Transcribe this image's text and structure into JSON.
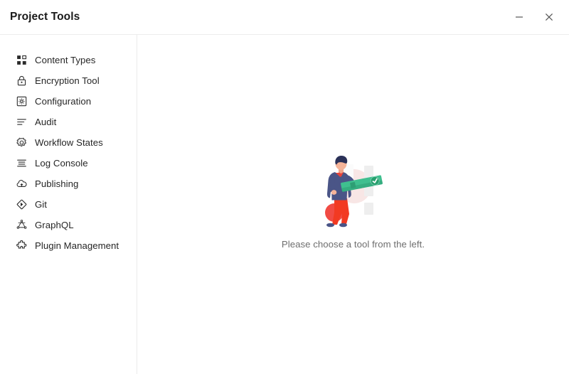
{
  "window": {
    "title": "Project Tools",
    "controls": [
      {
        "name": "minimize-button",
        "icon": "minimize-icon",
        "label": "Minimize"
      },
      {
        "name": "close-button",
        "icon": "close-icon",
        "label": "Close"
      }
    ]
  },
  "sidebar": {
    "items": [
      {
        "label": "Content Types",
        "icon": "grid-icon"
      },
      {
        "label": "Encryption Tool",
        "icon": "lock-icon"
      },
      {
        "label": "Configuration",
        "icon": "settings-square-icon"
      },
      {
        "label": "Audit",
        "icon": "list-lines-icon"
      },
      {
        "label": "Workflow States",
        "icon": "gear-icon"
      },
      {
        "label": "Log Console",
        "icon": "log-lines-icon"
      },
      {
        "label": "Publishing",
        "icon": "cloud-upload-icon"
      },
      {
        "label": "Git",
        "icon": "git-diamond-icon"
      },
      {
        "label": "GraphQL",
        "icon": "graphql-icon"
      },
      {
        "label": "Plugin Management",
        "icon": "puzzle-icon"
      }
    ]
  },
  "main": {
    "empty_state": {
      "illustration": "person-holding-approved-banner-illustration",
      "caption": "Please choose a tool from the left."
    }
  },
  "colors": {
    "text_primary": "#262626",
    "text_muted": "#6e6e6e",
    "divider": "#ebebeb",
    "jacket_navy": "#4a5587",
    "shirt_red": "#e8433a",
    "pants_red": "#f23a22",
    "hair_navy": "#2b3158",
    "banner_green": "#3fbf8f",
    "banner_green_dark": "#2e9e74",
    "badge_green": "#28a06f",
    "bg_pink": "#f7dedc",
    "bg_gray": "#e8e8e8",
    "skin": "#f0a58c"
  }
}
